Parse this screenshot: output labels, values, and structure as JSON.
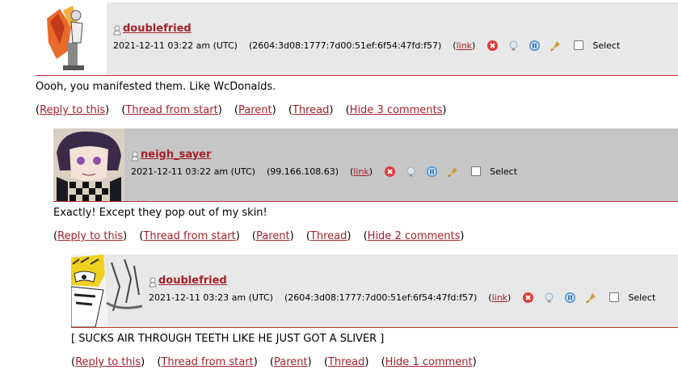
{
  "comments": [
    {
      "username": "doublefried",
      "timestamp": "2021-12-11 03:22 am (UTC)",
      "ip": "(2604:3d08:1777:7d00:51ef:6f54:47fd:f57)",
      "link_label": "link",
      "select_label": "Select",
      "body": "Oooh, you manifested them. Like WcDonalds.",
      "actions": [
        "Reply to this",
        "Thread from start",
        "Parent",
        "Thread",
        "Hide 3 comments"
      ]
    },
    {
      "username": "neigh_sayer",
      "timestamp": "2021-12-11 03:22 am (UTC)",
      "ip": "(99.166.108.63)",
      "link_label": "link",
      "select_label": "Select",
      "body": "Exactly! Except they pop out of my skin!",
      "actions": [
        "Reply to this",
        "Thread from start",
        "Parent",
        "Thread",
        "Hide 2 comments"
      ]
    },
    {
      "username": "doublefried",
      "timestamp": "2021-12-11 03:23 am (UTC)",
      "ip": "(2604:3d08:1777:7d00:51ef:6f54:47fd:f57)",
      "link_label": "link",
      "select_label": "Select",
      "body": "[ SUCKS AIR THROUGH TEETH LIKE HE JUST GOT A SLIVER ]",
      "actions": [
        "Reply to this",
        "Thread from start",
        "Parent",
        "Thread",
        "Hide 1 comment"
      ]
    }
  ],
  "icons": {
    "user": "user-icon",
    "delete": "delete-icon",
    "track": "track-icon",
    "freeze": "freeze-icon",
    "screen": "screen-icon"
  },
  "colors": {
    "link": "#a3222a",
    "header_light": "#e8e8e8",
    "header_dark": "#c6c6c6",
    "border": "#c03030"
  }
}
